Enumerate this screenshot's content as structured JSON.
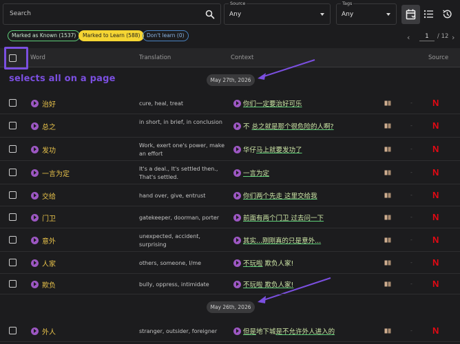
{
  "search": {
    "placeholder": "Search"
  },
  "source_select": {
    "label": "Source",
    "value": "Any"
  },
  "tags_select": {
    "label": "Tags",
    "value": "Any"
  },
  "chips": {
    "known": "Marked as Known (1537)",
    "learn": "Marked to Learn (588)",
    "dont": "Don't learn (0)"
  },
  "pager": {
    "page": "1",
    "total": "/ 12"
  },
  "columns": {
    "word": "Word",
    "translation": "Translation",
    "context": "Context",
    "source": "Source"
  },
  "annotation": "selects all on a page",
  "dates": [
    "May 27th, 2026",
    "May 26th, 2026"
  ],
  "rows": [
    {
      "word": "治好",
      "translation": "cure, heal, treat",
      "context": "你们一定要治好可乐"
    },
    {
      "word": "总之",
      "translation": "in short, in brief, in conclusion",
      "context": "不 总之就是那个很危险的人啊?"
    },
    {
      "word": "发功",
      "translation": "Work, exert one's power, make an effort",
      "context": "华仔马上就要发功了"
    },
    {
      "word": "一言为定",
      "translation": "It's a deal., It's settled then., That's settled.",
      "context": "一言为定"
    },
    {
      "word": "交给",
      "translation": "hand over, give, entrust",
      "context": "你们两个先走 这里交给我"
    },
    {
      "word": "门卫",
      "translation": "gatekeeper, doorman, porter",
      "context": "前面有两个门卫 过去问一下"
    },
    {
      "word": "意外",
      "translation": "unexpected, accident, surprising",
      "context": "其实...刚刚真的只是意外..."
    },
    {
      "word": "人家",
      "translation": "others, someone, I/me",
      "context": "不玩啦 欺负人家!"
    },
    {
      "word": "欺负",
      "translation": "bully, oppress, intimidate",
      "context": "不玩啦 欺负人家!"
    },
    {
      "word": "外人",
      "translation": "stranger, outsider, foreigner",
      "context": "但是地下城是不允许外人进入的"
    }
  ],
  "source_badge": "N",
  "dash": "-",
  "colors": {
    "accent": "#7b4fe0",
    "word": "#e8c24a",
    "play": "#9c57c2",
    "netflix": "#e50914"
  }
}
